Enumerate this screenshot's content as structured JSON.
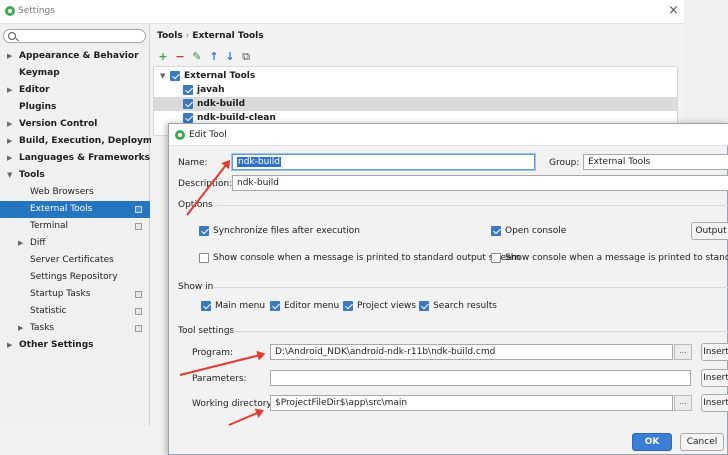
{
  "settings": {
    "title": "Settings",
    "close": "×",
    "search": {
      "value": "",
      "placeholder": ""
    },
    "sidebar": [
      {
        "label": "Appearance & Behavior",
        "arrow": "▶",
        "bold": true
      },
      {
        "label": "Keymap",
        "arrow": "",
        "bold": true
      },
      {
        "label": "Editor",
        "arrow": "▶",
        "bold": true
      },
      {
        "label": "Plugins",
        "arrow": "",
        "bold": true
      },
      {
        "label": "Version Control",
        "arrow": "▶",
        "bold": true
      },
      {
        "label": "Build, Execution, Deployment",
        "arrow": "▶",
        "bold": true
      },
      {
        "label": "Languages & Frameworks",
        "arrow": "▶",
        "bold": true
      },
      {
        "label": "Tools",
        "arrow": "▼",
        "bold": true
      },
      {
        "label": "Web Browsers",
        "arrow": "",
        "bold": false
      },
      {
        "label": "External Tools",
        "arrow": "",
        "bold": false,
        "selected": true,
        "project_icon": true
      },
      {
        "label": "Terminal",
        "arrow": "",
        "bold": false,
        "project_icon": true
      },
      {
        "label": "Diff",
        "arrow": "▶",
        "bold": false
      },
      {
        "label": "Server Certificates",
        "arrow": "",
        "bold": false
      },
      {
        "label": "Settings Repository",
        "arrow": "",
        "bold": false
      },
      {
        "label": "Startup Tasks",
        "arrow": "",
        "bold": false,
        "project_icon": true
      },
      {
        "label": "Statistic",
        "arrow": "",
        "bold": false,
        "project_icon": true
      },
      {
        "label": "Tasks",
        "arrow": "▶",
        "bold": false,
        "project_icon": true
      },
      {
        "label": "Other Settings",
        "arrow": "▶",
        "bold": true
      }
    ],
    "breadcrumb": [
      "Tools",
      "External Tools"
    ],
    "breadcrumb_sep": "›",
    "toolbar": {
      "add": "+",
      "remove": "−",
      "edit": "✎",
      "up": "↑",
      "down": "↓",
      "copy": "⧉"
    },
    "tools_tree": [
      {
        "label": "External Tools",
        "group": true,
        "arrow": "▼",
        "checked": true
      },
      {
        "label": "javah",
        "checked": true
      },
      {
        "label": "ndk-build",
        "checked": true,
        "selected": true
      },
      {
        "label": "ndk-build-clean",
        "checked": true
      }
    ]
  },
  "dialog": {
    "title": "Edit Tool",
    "name_label": "Name:",
    "name_value": "ndk-build",
    "group_label": "Group:",
    "group_value": "External Tools",
    "description_label": "Description:",
    "description_value": "ndk-build",
    "options_header": "Options",
    "options": {
      "sync": {
        "label": "Synchronize files after execution",
        "checked": true
      },
      "open_console": {
        "label": "Open console",
        "checked": true
      },
      "stdout": {
        "label": "Show console when a message is printed to standard output stream",
        "checked": false
      },
      "stderr": {
        "label": "Show console when a message is printed to standard error",
        "checked": false
      },
      "output_button": "Output"
    },
    "show_in_header": "Show in",
    "show_in": [
      {
        "label": "Main menu",
        "checked": true
      },
      {
        "label": "Editor menu",
        "checked": true
      },
      {
        "label": "Project views",
        "checked": true
      },
      {
        "label": "Search results",
        "checked": true
      }
    ],
    "tool_settings_header": "Tool settings",
    "program_label": "Program:",
    "program_value": "D:\\Android_NDK\\android-ndk-r11b\\ndk-build.cmd",
    "parameters_label": "Parameters:",
    "parameters_value": "",
    "working_dir_label": "Working directory:",
    "working_dir_value": "$ProjectFileDir$\\app\\src\\main",
    "browse": "...",
    "insert_button": "Insert",
    "ok": "OK",
    "cancel": "Cancel"
  },
  "colors": {
    "accent": "#2675bf",
    "annotation": "#e53a2f",
    "ok_button": "#3a7ed6"
  }
}
